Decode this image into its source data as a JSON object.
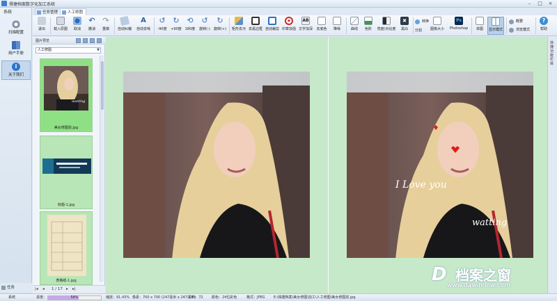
{
  "window": {
    "title": "得捷档案数字化加工系统",
    "min": "–",
    "max": "□",
    "close": "×"
  },
  "sidebar": {
    "system_label": "系统",
    "items": [
      {
        "label": "扫描配置",
        "icon": "gear-icon"
      },
      {
        "label": "用户手册",
        "icon": "book-icon"
      },
      {
        "label": "关于我们",
        "icon": "info-icon"
      }
    ],
    "tasks_label": "任务"
  },
  "tabs": [
    {
      "label": "任务管理"
    },
    {
      "label": "人工修图"
    }
  ],
  "toolbar": {
    "items": [
      {
        "label": "退出"
      },
      {
        "label": "载入原图"
      },
      {
        "label": "取消"
      },
      {
        "label": "撤消"
      },
      {
        "label": "重做"
      },
      {
        "label": "自动纠偏"
      },
      {
        "label": "自动去噪"
      },
      {
        "label": "-90度"
      },
      {
        "label": "+90度"
      },
      {
        "label": "180度"
      },
      {
        "label": "旋转(-)"
      },
      {
        "label": "旋转(+)"
      },
      {
        "label": "矩形去污"
      },
      {
        "label": "去黑边框"
      },
      {
        "label": "自动裁剪"
      },
      {
        "label": "印章加强"
      },
      {
        "label": "文字加深"
      },
      {
        "label": "去底色"
      },
      {
        "label": "降噪"
      },
      {
        "label": "曲线"
      },
      {
        "label": "色阶"
      },
      {
        "label": "亮度/对比度"
      },
      {
        "label": "黑白"
      },
      {
        "label": "分割"
      },
      {
        "label": "图像大小"
      },
      {
        "label": "Photoshop"
      },
      {
        "label": "单图"
      },
      {
        "label": "显示模式"
      },
      {
        "label": "帮助"
      }
    ],
    "small_right": [
      {
        "label": "转换"
      },
      {
        "label": "概要"
      },
      {
        "label": "浏览模式"
      }
    ]
  },
  "left_panel": {
    "header": "图片预览",
    "folder": "人工修图",
    "thumbs": [
      {
        "caption": "美女修图前.jpg"
      },
      {
        "caption": "标题-1.jpg"
      },
      {
        "caption": "表格纸-1.jpg"
      }
    ],
    "pager": {
      "first": "|◂",
      "prev": "◂",
      "page": "1 / 17",
      "next": "▸",
      "last": "▸|"
    }
  },
  "viewer": {
    "overlay_line1": "I  Love  you",
    "overlay_line2": "watting"
  },
  "right_strip": {
    "label": "快捷功能栏目"
  },
  "status": {
    "progress_label": "进度：",
    "progress_pct": 58,
    "progress_text": "58%",
    "zoom": "缩放：91.43%",
    "size": "像素：700 x 700 (247毫米 x 247毫米)",
    "dpi": "DPI：72",
    "color": "颜色：24位彩色",
    "format": "格式：JPEG",
    "path": "E:\\得捷档案\\美女修图\\加工\\人工修图\\美女修图前.jpg",
    "system": "系统"
  },
  "watermark": {
    "brand": "档案之窗",
    "url": "www.dawindow.com"
  },
  "colors": {
    "viewer_bg": "#c6e9c9",
    "thumb_selected": "#8fe085",
    "progress": "#c9a7e8"
  }
}
